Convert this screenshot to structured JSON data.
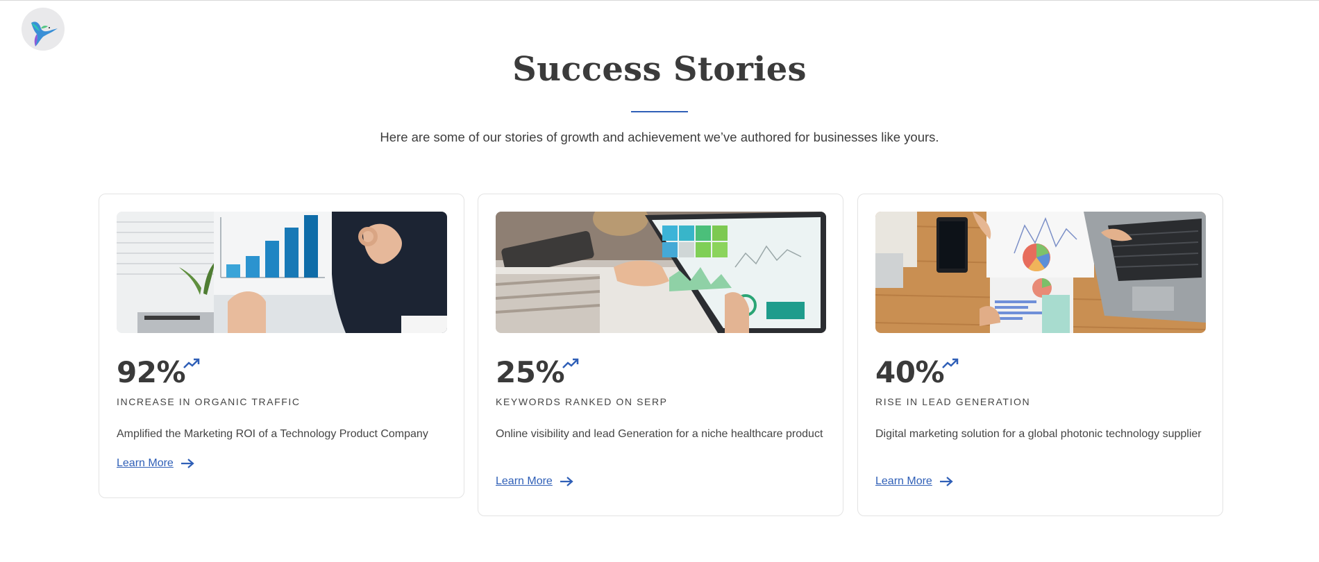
{
  "page": {
    "title": "Success Stories",
    "subtitle": "Here are some of our stories of growth and achievement we’ve authored for businesses like yours."
  },
  "colors": {
    "accent": "#2f5fb7",
    "text": "#3a3a3a",
    "card_border": "#e3e3e3"
  },
  "icons": {
    "logo": "hummingbird-logo",
    "trend": "trending-up-icon",
    "arrow": "arrow-right-icon"
  },
  "cards": [
    {
      "stat": "92%",
      "label": "INCREASE IN ORGANIC TRAFFIC",
      "description": "Amplified the Marketing ROI of a Technology Product Company",
      "link": "Learn More",
      "image": "bar-chart-presentation-photo"
    },
    {
      "stat": "25%",
      "label": "KEYWORDS RANKED ON SERP",
      "description": "Online visibility and lead Generation for a niche healthcare product",
      "link": "Learn More",
      "image": "tablet-analytics-dashboard-photo"
    },
    {
      "stat": "40%",
      "label": "RISE IN LEAD GENERATION",
      "description": "Digital marketing solution for a global photonic technology supplier",
      "link": "Learn More",
      "image": "desk-reports-laptop-photo"
    }
  ]
}
